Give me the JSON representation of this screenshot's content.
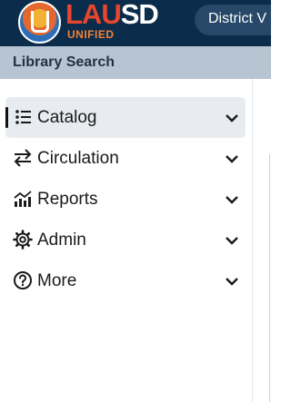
{
  "header": {
    "logo_text_1": "LAU",
    "logo_text_2": "SD",
    "logo_subtext": "UNIFIED",
    "district_button": "District V"
  },
  "subheader": {
    "title": "Library Search"
  },
  "menu": {
    "items": [
      {
        "label": "Catalog",
        "icon": "list-icon",
        "active": true
      },
      {
        "label": "Circulation",
        "icon": "swap-arrows-icon",
        "active": false
      },
      {
        "label": "Reports",
        "icon": "chart-icon",
        "active": false
      },
      {
        "label": "Admin",
        "icon": "gear-icon",
        "active": false
      },
      {
        "label": "More",
        "icon": "help-circle-icon",
        "active": false
      }
    ]
  },
  "colors": {
    "header_bg": "#0b2c4a",
    "subheader_bg": "#b7c4d1",
    "active_item_bg": "#e8ecf0",
    "logo_red": "#e8452f",
    "logo_orange": "#f0823a"
  }
}
